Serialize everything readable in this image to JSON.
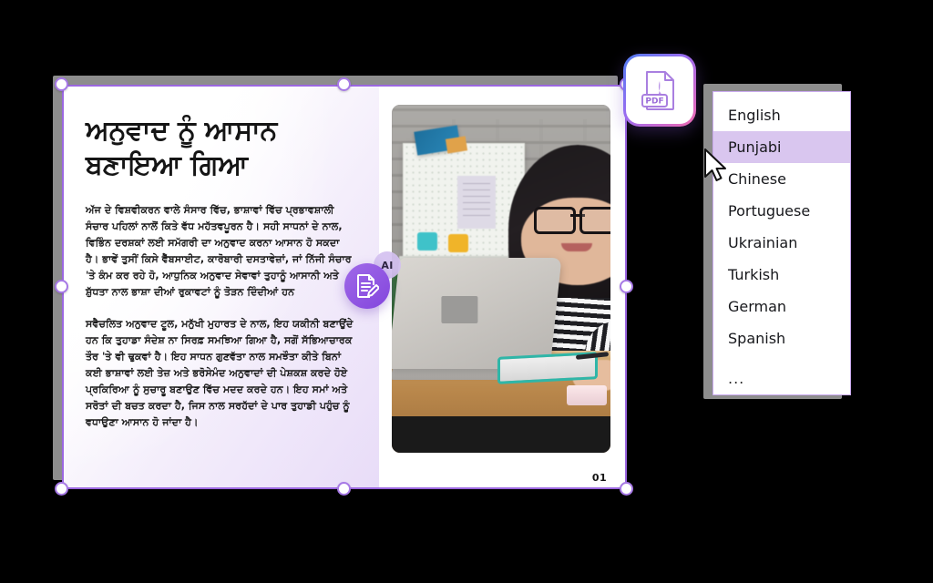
{
  "document": {
    "title": "ਅਨੁਵਾਦ ਨੂੰ ਆਸਾਨ ਬਣਾਇਆ ਗਿਆ",
    "paragraphs": [
      "ਅੱਜ ਦੇ ਵਿਸ਼ਵੀਕਰਨ ਵਾਲੇ ਸੰਸਾਰ ਵਿੱਚ, ਭਾਸ਼ਾਵਾਂ ਵਿੱਚ ਪ੍ਰਭਾਵਸ਼ਾਲੀ ਸੰਚਾਰ ਪਹਿਲਾਂ ਨਾਲੋਂ ਕਿਤੇ ਵੱਧ ਮਹੱਤਵਪੂਰਨ ਹੈ। ਸਹੀ ਸਾਧਨਾਂ ਦੇ ਨਾਲ, ਵਿਭਿੰਨ ਦਰਸ਼ਕਾਂ ਲਈ ਸਮੱਗਰੀ ਦਾ ਅਨੁਵਾਦ ਕਰਨਾ ਆਸਾਨ ਹੋ ਸਕਦਾ ਹੈ। ਭਾਵੇਂ ਤੁਸੀਂ ਕਿਸੇ ਵੈੱਬਸਾਈਟ, ਕਾਰੋਬਾਰੀ ਦਸਤਾਵੇਜ਼ਾਂ, ਜਾਂ ਨਿੱਜੀ ਸੰਚਾਰ 'ਤੇ ਕੰਮ ਕਰ ਰਹੇ ਹੋ, ਆਧੁਨਿਕ ਅਨੁਵਾਦ ਸੇਵਾਵਾਂ ਤੁਹਾਨੂੰ ਆਸਾਨੀ ਅਤੇ ਸ਼ੁੱਧਤਾ ਨਾਲ ਭਾਸ਼ਾ ਦੀਆਂ ਰੁਕਾਵਟਾਂ ਨੂੰ ਤੋੜਨ ਦਿੰਦੀਆਂ ਹਨ",
      "ਸਵੈਚਲਿਤ ਅਨੁਵਾਦ ਟੂਲ, ਮਨੁੱਖੀ ਮੁਹਾਰਤ ਦੇ ਨਾਲ, ਇਹ ਯਕੀਨੀ ਬਣਾਉਂਦੇ ਹਨ ਕਿ ਤੁਹਾਡਾ ਸੰਦੇਸ਼ ਨਾ ਸਿਰਫ਼ ਸਮਝਿਆ ਗਿਆ ਹੈ, ਸਗੋਂ ਸੱਭਿਆਚਾਰਕ ਤੌਰ 'ਤੇ ਵੀ ਢੁਕਵਾਂ ਹੈ। ਇਹ ਸਾਧਨ ਗੁਣਵੱਤਾ ਨਾਲ ਸਮਝੌਤਾ ਕੀਤੇ ਬਿਨਾਂ ਕਈ ਭਾਸ਼ਾਵਾਂ ਲਈ ਤੇਜ਼ ਅਤੇ ਭਰੋਸੇਮੰਦ ਅਨੁਵਾਦਾਂ ਦੀ ਪੇਸ਼ਕਸ਼ ਕਰਦੇ ਹੋਏ ਪ੍ਰਕਿਰਿਆ ਨੂੰ ਸੁਚਾਰੂ ਬਣਾਉਣ ਵਿੱਚ ਮਦਦ ਕਰਦੇ ਹਨ। ਇਹ ਸਮਾਂ ਅਤੇ ਸਰੋਤਾਂ ਦੀ ਬਚਤ ਕਰਦਾ ਹੈ, ਜਿਸ ਨਾਲ ਸਰਹੱਦਾਂ ਦੇ ਪਾਰ ਤੁਹਾਡੀ ਪਹੁੰਚ ਨੂੰ ਵਧਾਉਣਾ ਆਸਾਨ ਹੋ ਜਾਂਦਾ ਹੈ।"
    ],
    "page_number": "01",
    "photo_alt": "woman-at-laptop-photo"
  },
  "badges": {
    "pdf_label": "PDF",
    "pdf_icon": "pdf-file-icon",
    "ai_label": "AI",
    "ai_icon": "document-edit-icon"
  },
  "language_dropdown": {
    "items": [
      {
        "label": "English",
        "selected": false
      },
      {
        "label": "Punjabi",
        "selected": true
      },
      {
        "label": "Chinese",
        "selected": false
      },
      {
        "label": "Portuguese",
        "selected": false
      },
      {
        "label": "Ukrainian",
        "selected": false
      },
      {
        "label": "Turkish",
        "selected": false
      },
      {
        "label": "German",
        "selected": false
      },
      {
        "label": "Spanish",
        "selected": false
      },
      {
        "label": "...",
        "selected": false
      }
    ]
  },
  "colors": {
    "selection_border": "#9b67e0",
    "handle_fill": "#ffffff",
    "handle_border": "#a779e6",
    "dropdown_highlight": "#d9c6ef",
    "dropdown_border": "#c9a9ee",
    "ai_badge": "#8346dd",
    "canvas_background": "#000000"
  },
  "cursor": {
    "type": "arrow-cursor"
  }
}
